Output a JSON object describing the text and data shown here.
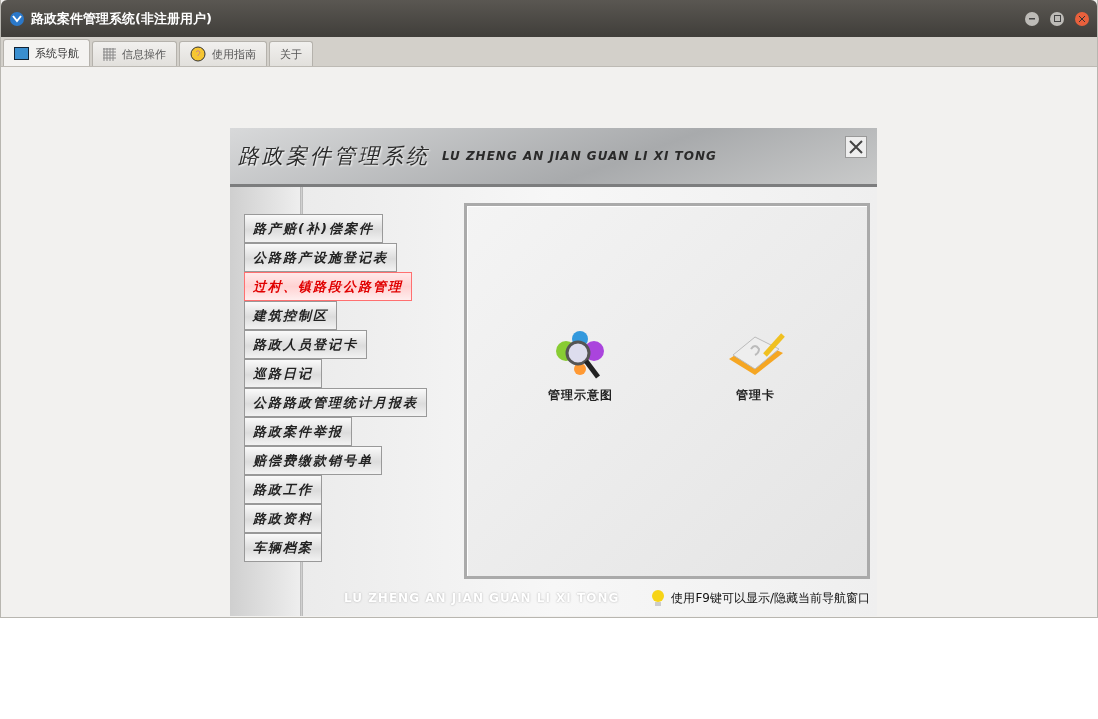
{
  "window": {
    "title": "路政案件管理系统(非注册用户)"
  },
  "tabs": [
    {
      "label": "系统导航",
      "selected": true
    },
    {
      "label": "信息操作",
      "selected": false
    },
    {
      "label": "使用指南",
      "selected": false
    },
    {
      "label": "关于",
      "selected": false
    }
  ],
  "panel": {
    "title": "路政案件管理系统",
    "subtitle": "LU ZHENG AN JIAN GUAN LI XI TONG",
    "menu": [
      {
        "label": "路产赔(补)偿案件",
        "selected": false
      },
      {
        "label": "公路路产设施登记表",
        "selected": false
      },
      {
        "label": "过村、镇路段公路管理",
        "selected": true
      },
      {
        "label": "建筑控制区",
        "selected": false
      },
      {
        "label": "路政人员登记卡",
        "selected": false
      },
      {
        "label": "巡路日记",
        "selected": false
      },
      {
        "label": "公路路政管理统计月报表",
        "selected": false
      },
      {
        "label": "路政案件举报",
        "selected": false
      },
      {
        "label": "赔偿费缴款销号单",
        "selected": false
      },
      {
        "label": "路政工作",
        "selected": false
      },
      {
        "label": "路政资料",
        "selected": false
      },
      {
        "label": "车辆档案",
        "selected": false
      }
    ],
    "actions": [
      {
        "label": "管理示意图",
        "kind": "diagram"
      },
      {
        "label": "管理卡",
        "kind": "card"
      }
    ],
    "footer_reflection": "LU ZHENG AN JIAN GUAN LI XI TONG",
    "hint": "使用F9键可以显示/隐藏当前导航窗口"
  }
}
